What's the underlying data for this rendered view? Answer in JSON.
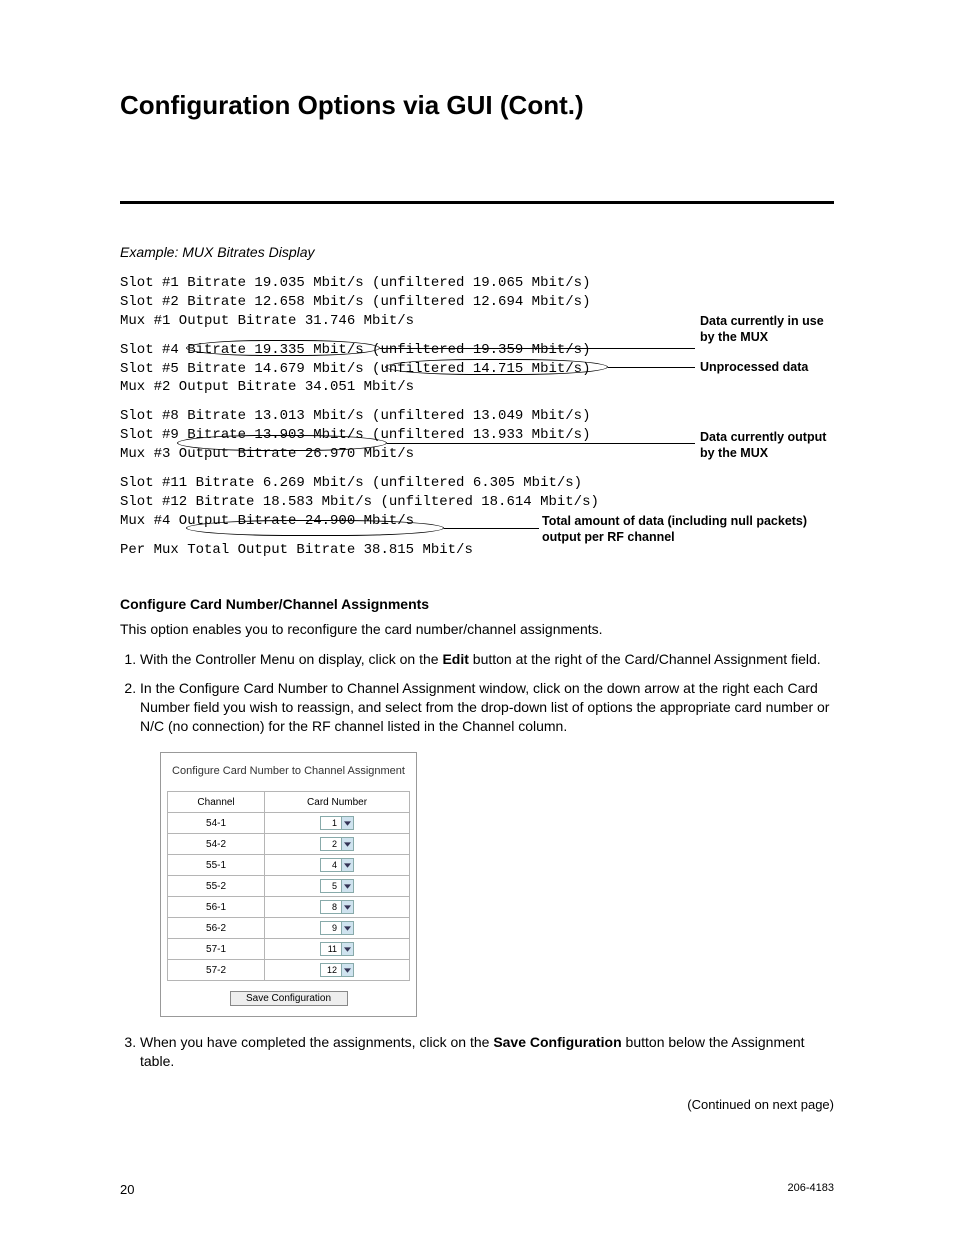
{
  "title": "Configuration Options via GUI (Cont.)",
  "example_caption": "Example: MUX Bitrates Display",
  "mux": {
    "group1": "Slot #1 Bitrate 19.035 Mbit/s (unfiltered 19.065 Mbit/s)\nSlot #2 Bitrate 12.658 Mbit/s (unfiltered 12.694 Mbit/s)\nMux #1 Output Bitrate 31.746 Mbit/s",
    "group2": "Slot #4 Bitrate 19.335 Mbit/s (unfiltered 19.359 Mbit/s)\nSlot #5 Bitrate 14.679 Mbit/s (unfiltered 14.715 Mbit/s)\nMux #2 Output Bitrate 34.051 Mbit/s",
    "group3": "Slot #8 Bitrate 13.013 Mbit/s (unfiltered 13.049 Mbit/s)\nSlot #9 Bitrate 13.903 Mbit/s (unfiltered 13.933 Mbit/s)\nMux #3 Output Bitrate 26.970 Mbit/s",
    "group4": "Slot #11 Bitrate 6.269 Mbit/s (unfiltered 6.305 Mbit/s)\nSlot #12 Bitrate 18.583 Mbit/s (unfiltered 18.614 Mbit/s)\nMux #4 Output Bitrate 24.900 Mbit/s",
    "permux": "Per Mux Total Output Bitrate 38.815 Mbit/s"
  },
  "labels": {
    "in_use": "Data currently in use by the MUX",
    "unprocessed": "Unprocessed data",
    "output_by_mux": "Data currently output by the MUX",
    "total": "Total amount of data (including null packets) output per RF channel"
  },
  "section_heading": "Configure Card Number/Channel Assignments",
  "intro": "This option enables you to reconfigure the card number/channel assignments.",
  "steps": {
    "s1a": "With the Controller Menu on display, click on the ",
    "s1_bold": "Edit",
    "s1b": " button at the right of the Card/Channel Assignment field.",
    "s2": "In the Configure Card Number to Channel Assignment window, click on the down arrow at the right each Card Number field you wish to reassign, and select from the drop-down list of options the appropriate card number or N/C (no connection) for the RF channel listed in the Channel column.",
    "s3a": "When you have completed the assignments, click on the ",
    "s3_bold": "Save Configuration",
    "s3b": " button below the Assignment table."
  },
  "window": {
    "title": "Configure Card Number to Channel Assignment",
    "col_channel": "Channel",
    "col_card": "Card Number",
    "rows": [
      {
        "channel": "54-1",
        "card": "1"
      },
      {
        "channel": "54-2",
        "card": "2"
      },
      {
        "channel": "55-1",
        "card": "4"
      },
      {
        "channel": "55-2",
        "card": "5"
      },
      {
        "channel": "56-1",
        "card": "8"
      },
      {
        "channel": "56-2",
        "card": "9"
      },
      {
        "channel": "57-1",
        "card": "11"
      },
      {
        "channel": "57-2",
        "card": "12"
      }
    ],
    "save_label": "Save Configuration"
  },
  "continued": "(Continued on next page)",
  "footer": {
    "page": "20",
    "doc": "206-4183"
  }
}
